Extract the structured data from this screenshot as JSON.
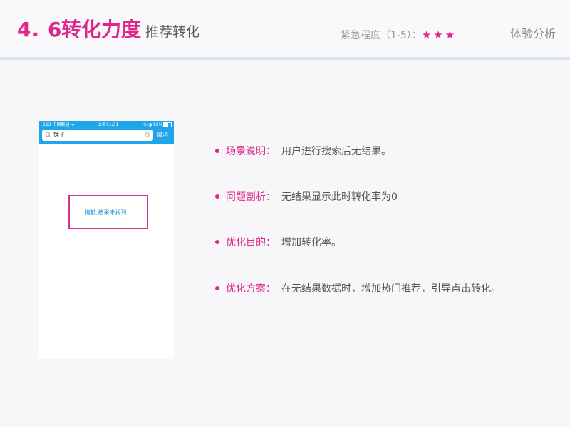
{
  "header": {
    "section_number": "4. 6",
    "title": "转化力度",
    "subtitle": "推荐转化",
    "urgency_label": "紧急程度（1-5）：",
    "urgency_stars": "★★★",
    "urgency_level": 3,
    "category": "体验分析"
  },
  "phone": {
    "status_left": "-112 中国联通 ᯤ",
    "status_time": "上午11:21",
    "status_right": "⊕ ◑ 55%",
    "battery_level": 0.55,
    "search_value": "锤子",
    "cancel_label": "取消",
    "no_result_text": "抱歉,结果未找到..."
  },
  "bullets": [
    {
      "label": "场景说明：",
      "text": "用户进行搜索后无结果。"
    },
    {
      "label": "问题剖析：",
      "text": "无结果显示此时转化率为0"
    },
    {
      "label": "优化目的：",
      "text": "增加转化率。"
    },
    {
      "label": "优化方案：",
      "text": "在无结果数据时，增加热门推荐，引导点击转化。"
    }
  ],
  "colors": {
    "accent": "#e0268a",
    "phone_bar": "#1fa6e8",
    "link_blue": "#1f8fd6",
    "highlight_border": "#d6338e"
  }
}
